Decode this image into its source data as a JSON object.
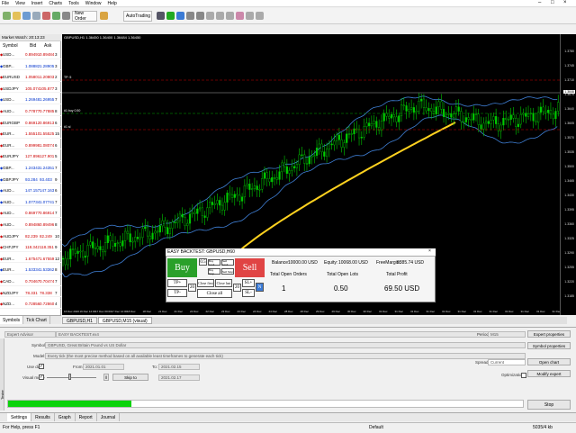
{
  "menu": [
    "File",
    "View",
    "Insert",
    "Charts",
    "Tools",
    "Window",
    "Help"
  ],
  "toolbar": {
    "new_order": "New Order",
    "autotrading": "AutoTrading"
  },
  "market_watch": {
    "title": "Market Watch: 20:13:23",
    "headers": [
      "Symbol",
      "Bid",
      "Ask",
      ""
    ],
    "rows": [
      [
        "USD...",
        "0.89491",
        "0.89484",
        "3"
      ],
      [
        "GBP...",
        "1.08882",
        "1.28905",
        "3"
      ],
      [
        "EURUSD",
        "1.05801",
        "1.20803",
        "2"
      ],
      [
        "USDJPY",
        "105.074",
        "105.877",
        "3"
      ],
      [
        "USD...",
        "1.26948",
        "1.26955",
        "7"
      ],
      [
        "AUD...",
        "0.77877",
        "0.77885",
        "8"
      ],
      [
        "EURGBP",
        "0.86912",
        "0.86913",
        "6"
      ],
      [
        "EUR...",
        "1.55510",
        "1.55525",
        "15"
      ],
      [
        "EUR...",
        "0.89998",
        "1.08074",
        "6"
      ],
      [
        "EURJPY",
        "127.896",
        "127.901",
        "5"
      ],
      [
        "GBP...",
        "1.24343",
        "1.24351",
        "7"
      ],
      [
        "GBPJPY",
        "93.284",
        "93.403",
        "9"
      ],
      [
        "AUD...",
        "147.157",
        "147.163",
        "6"
      ],
      [
        "AUD...",
        "1.07734",
        "1.07741",
        "7"
      ],
      [
        "AUD...",
        "0.86977",
        "0.86914",
        "7"
      ],
      [
        "AUD...",
        "0.89486",
        "0.89496",
        "8"
      ],
      [
        "AUDJPY",
        "82.239",
        "82.249",
        "10"
      ],
      [
        "CHFJPY",
        "118.342",
        "118.351",
        "9"
      ],
      [
        "EUR...",
        "1.67547",
        "1.67559",
        "12"
      ],
      [
        "EUR...",
        "1.53334",
        "1.53362",
        "8"
      ],
      [
        "CAD...",
        "0.70467",
        "0.70474",
        "7"
      ],
      [
        "NZDJPY",
        "78.331",
        "78.338",
        "7"
      ],
      [
        "NZD...",
        "0.72856",
        "0.72860",
        "4"
      ]
    ],
    "tabs": [
      "Symbols",
      "Tick Chart"
    ]
  },
  "chart": {
    "label": "GBPUSD,H1  1.36450 1.36400 1.36484 1.36450",
    "line_labels": {
      "tp": "TP: 5",
      "buy": "#1 buy 0.50",
      "sl": "#1 sl"
    },
    "price_label": "1.3646",
    "y_ticks": [
      "1.3780",
      "1.3745",
      "1.3710",
      "1.3675",
      "1.3640",
      "1.3605",
      "1.3570",
      "1.3535",
      "1.3500",
      "1.3465",
      "1.3430",
      "1.3395",
      "1.3360",
      "1.3325",
      "1.3290",
      "1.3255",
      "1.3220",
      "1.3185"
    ],
    "x_ticks": [
      "16 Dec 2020",
      "16 Dec 12:00",
      "17 Dec 00:00",
      "17 Dec 12:00",
      "18 Dec",
      "18 Dec",
      "21 Dec",
      "21 Dec",
      "22 Dec",
      "22 Dec",
      "23 Dec",
      "23 Dec",
      "24 Dec",
      "24 Dec",
      "28 Dec",
      "28 Dec",
      "29 Dec",
      "29 Dec",
      "30 Dec",
      "30 Dec",
      "31 Dec",
      "31 Dec",
      "31 Dec",
      "31 Dec",
      "31 Dec",
      "31 Dec",
      "31 Dec",
      "31 Dec",
      "31 Dec",
      "31 Dec",
      "31 Dec",
      "31 Dec 23:00"
    ],
    "tabs": [
      "GBPUSD,H1",
      "GBPUSD,M15 (visual)"
    ],
    "colors": {
      "candle": "#00cc00",
      "band": "#3f7fd5",
      "ma": "#ffd21f"
    }
  },
  "easy_panel": {
    "title": "EASY BACKTEST: GBPUSD,H60",
    "buy": "Buy",
    "sell": "Sell",
    "lot": "0.5",
    "small": [
      "Buy Limit",
      "Sell Limit",
      "Buy Stop",
      "Sell Stop"
    ],
    "tp_plus": "TP+",
    "tp_minus": "TP-",
    "close_first": "Close first",
    "close_last": "Close last",
    "close_all": "Close all",
    "sl_plus": "SL+",
    "sl_minus": "SL-",
    "tp_val": "20",
    "sl_val": "20",
    "mode": "N",
    "balance_label": "Balance:",
    "balance": "10000.00 USD",
    "equity_label": "Equity:",
    "equity": "10068.00 USD",
    "margin_label": "FreeMargin:",
    "margin": "9385.74 USD",
    "open_orders_label": "Total Open Orders",
    "open_orders": "1",
    "open_lots_label": "Total Open Lots",
    "open_lots": "0.50",
    "profit_label": "Total Profit",
    "profit": "69.50 USD"
  },
  "tester": {
    "type": "Expert Advisor",
    "ea": "EASY BACKTEST.ex4",
    "symbol_label": "Symbol:",
    "symbol": "GBPUSD, Great Britain Pound vs US Dollar",
    "model_label": "Model:",
    "model": "Every tick (the most precise method based on all available least timeframes to generate each tick)",
    "use_date": "Use date",
    "from_label": "From:",
    "from": "2021.01.01",
    "to_label": "To:",
    "to": "2021.02.15",
    "visual": "Visual mode",
    "skip": "Skip to",
    "skip_date": "2021.02.17",
    "period_label": "Period:",
    "period": "M15",
    "spread_label": "Spread:",
    "spread": "Current",
    "optimization": "Optimization",
    "buttons": [
      "Expert properties",
      "Symbol properties",
      "Open chart",
      "Modify expert"
    ],
    "stop": "Stop",
    "progress": 0.24,
    "tabs": [
      "Settings",
      "Results",
      "Graph",
      "Report",
      "Journal"
    ],
    "side_label": "Tester"
  },
  "status": {
    "help": "For Help, press F1",
    "profile": "Default",
    "conn": "5035/4 kb"
  }
}
